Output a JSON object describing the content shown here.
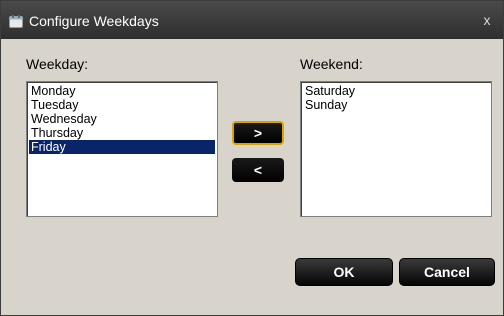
{
  "window": {
    "title": "Configure Weekdays",
    "close_glyph": "x"
  },
  "weekday_panel": {
    "label": "Weekday:",
    "items": [
      "Monday",
      "Tuesday",
      "Wednesday",
      "Thursday",
      "Friday"
    ],
    "selected": "Friday"
  },
  "weekend_panel": {
    "label": "Weekend:",
    "items": [
      "Saturday",
      "Sunday"
    ]
  },
  "move_buttons": {
    "to_weekend_label": ">",
    "to_weekday_label": "<"
  },
  "footer": {
    "ok_label": "OK",
    "cancel_label": "Cancel"
  },
  "colors": {
    "selection": "#0a246a",
    "focus_border": "#d9a400",
    "titlebar": "#3a3a3a"
  },
  "icons": {
    "title_icon": "calendar-icon"
  }
}
